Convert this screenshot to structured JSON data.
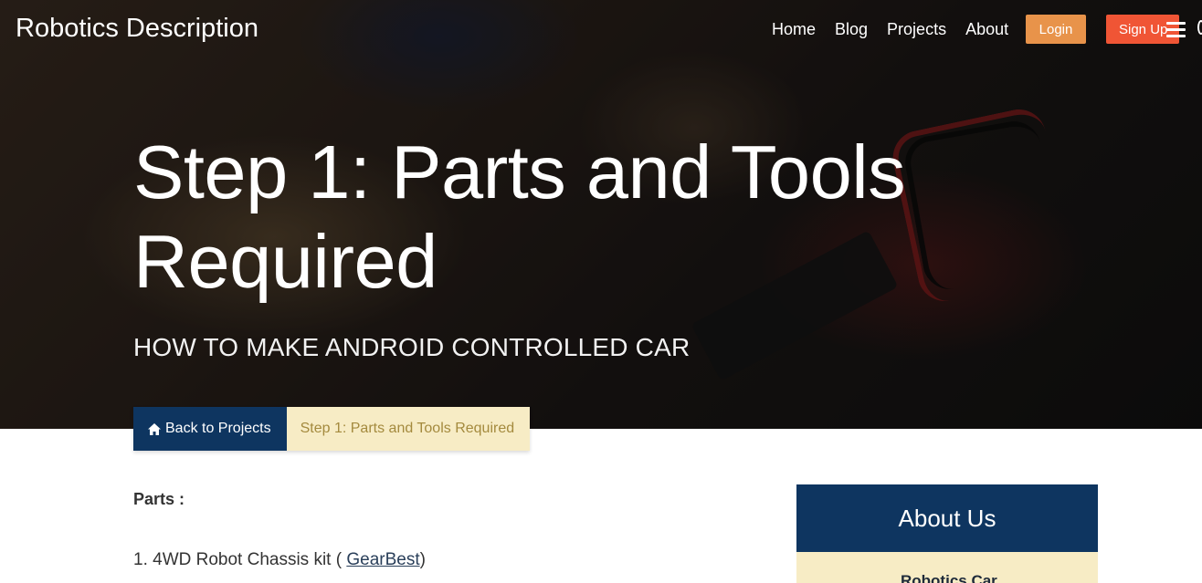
{
  "brand": {
    "bold": "Robotics",
    "light": "Description"
  },
  "nav": {
    "links": [
      "Home",
      "Blog",
      "Projects",
      "About"
    ],
    "login_label": "Login",
    "signup_label": "Sign Up"
  },
  "hero": {
    "title": "Step 1: Parts and Tools Required",
    "subtitle": "HOW TO MAKE ANDROID CONTROLLED CAR"
  },
  "breadcrumb": {
    "back_label": "Back to Projects",
    "current_label": "Step 1: Parts and Tools Required"
  },
  "content": {
    "parts_heading": "Parts :",
    "item_prefix": "1. 4WD Robot Chassis kit ( ",
    "item_link": "GearBest",
    "item_suffix": ")"
  },
  "sidebar": {
    "about_title": "About Us",
    "first_item": "Robotics Car"
  },
  "colors": {
    "navy": "#0e3560",
    "cream": "#f7ecc5",
    "login": "#e8934a",
    "signup": "#f05535"
  }
}
